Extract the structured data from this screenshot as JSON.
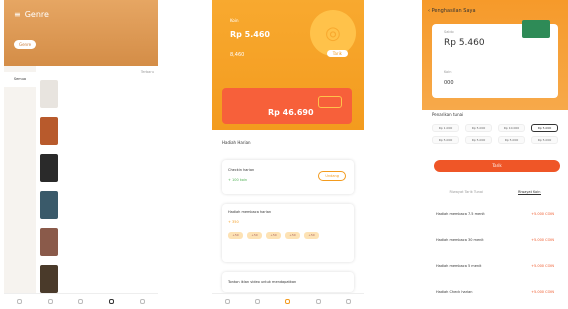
{
  "screen1": {
    "title": "Genre",
    "tabs": [
      "Genre",
      "",
      "",
      ""
    ],
    "filter_right": "Terbaru",
    "side_items": [
      "Semua",
      "",
      "",
      "",
      "",
      "",
      "",
      "",
      "",
      "",
      "",
      ""
    ],
    "items": [
      {
        "title": "",
        "desc": "",
        "color": "#e8e4df"
      },
      {
        "title": "",
        "desc": "",
        "color": "#b85a2c"
      },
      {
        "title": "",
        "desc": "",
        "color": "#2a2a2a"
      },
      {
        "title": "",
        "desc": "",
        "color": "#3a5a6a"
      },
      {
        "title": "",
        "desc": "",
        "color": "#8a5a4a"
      },
      {
        "title": "",
        "desc": "",
        "color": "#4a3a2a"
      }
    ]
  },
  "screen2": {
    "balance_label": "Koin",
    "balance": "Rp 5.460",
    "sub_balance": "8,460",
    "tarik_btn": "Tarik",
    "promo_text": "",
    "promo_amount": "Rp 46.690",
    "section_title": "Hadiah Harian",
    "checkin_label": "Checkin harian",
    "checkin_sub": "+ 100 koin",
    "checkin_btn": "Undang",
    "task_label": "Hadiah membaca harian",
    "task_sub": "+ 350",
    "steps": [
      "+50",
      "+50",
      "+50",
      "+50",
      "+50"
    ],
    "task2_label": "Tonton iklan video untuk mendapatkan"
  },
  "screen3": {
    "title": "Penghasilan Saya",
    "card_label": "Saldo",
    "balance": "Rp 5.460",
    "coin_label": "Koin",
    "coin_value": "000",
    "withdraw_label": "Penarikan tunai",
    "options": [
      "Rp 1.000",
      "Rp 5.000",
      "Rp 10.000",
      "Rp 5.000",
      "Rp 5.000",
      "Rp 5.000",
      "Rp 5.000",
      "Rp 5.000"
    ],
    "active_option": 3,
    "btn": "Tarik",
    "tabs": [
      "Riwayat Tarik Tunai",
      "Riwayat Koin"
    ],
    "rows": [
      {
        "title": "Hadiah membaca 7.5 menit",
        "amount": "+5.000 COIN"
      },
      {
        "title": "Hadiah membaca 30 menit",
        "amount": "+5.000 COIN"
      },
      {
        "title": "Hadiah membaca 5 menit",
        "amount": "+5.000 COIN"
      },
      {
        "title": "Hadiah Check harian",
        "amount": "+5.000 COIN"
      }
    ]
  }
}
